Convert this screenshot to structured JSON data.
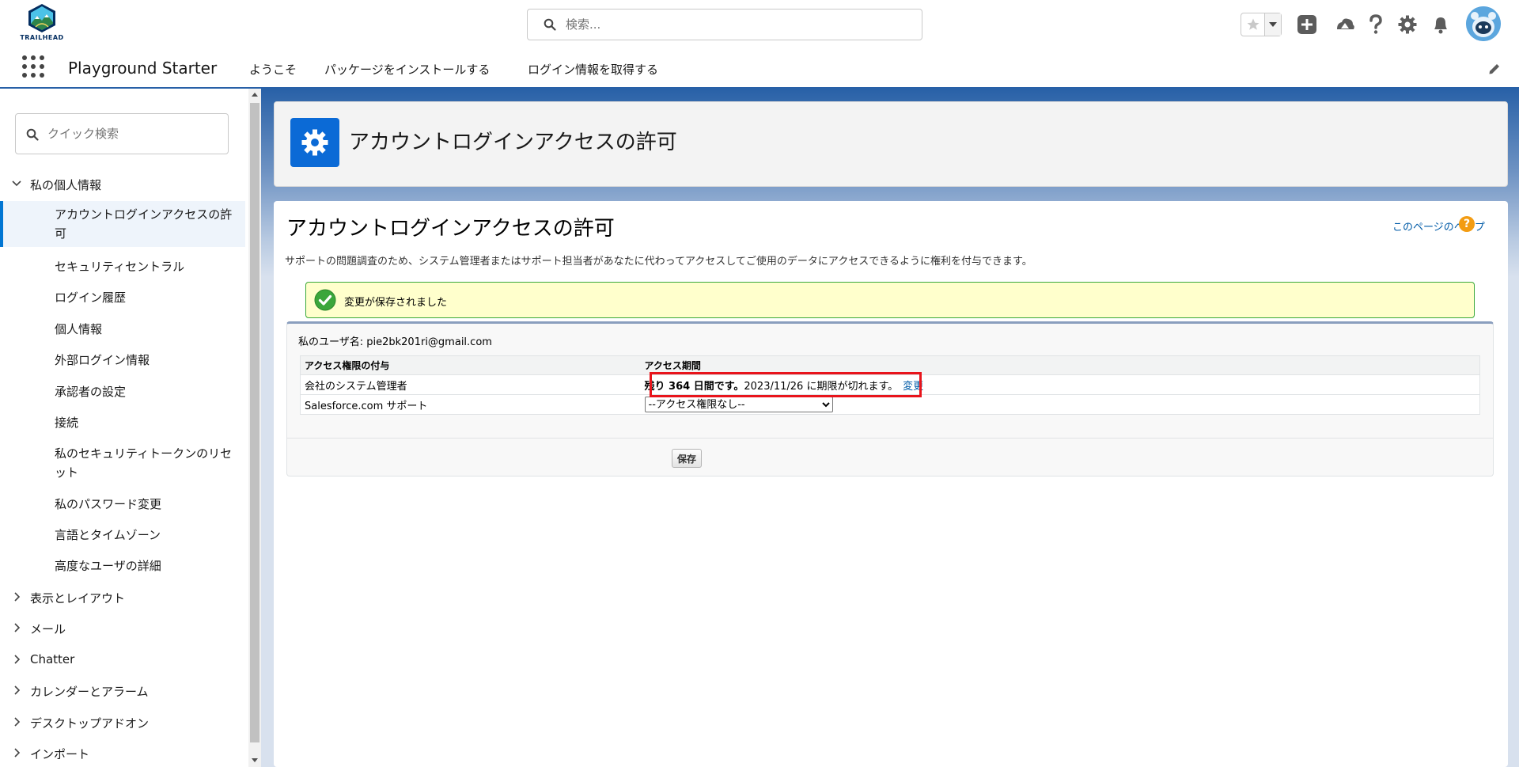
{
  "header": {
    "logo_text": "TRAILHEAD",
    "search_placeholder": "検索..."
  },
  "app_nav": {
    "app_name": "Playground Starter",
    "items": [
      "ようこそ",
      "パッケージをインストールする",
      "ログイン情報を取得する"
    ]
  },
  "sidebar": {
    "quick_find_placeholder": "クイック検索",
    "expanded_section": "私の個人情報",
    "children": [
      "アカウントログインアクセスの許可",
      "セキュリティセントラル",
      "ログイン履歴",
      "個人情報",
      "外部ログイン情報",
      "承認者の設定",
      "接続",
      "私のセキュリティトークンのリセット",
      "私のパスワード変更",
      "言語とタイムゾーン",
      "高度なユーザの詳細"
    ],
    "collapsed_sections": [
      "表示とレイアウト",
      "メール",
      "Chatter",
      "カレンダーとアラーム",
      "デスクトップアドオン",
      "インポート"
    ]
  },
  "page_header": {
    "title": "アカウントログインアクセスの許可"
  },
  "content": {
    "title": "アカウントログインアクセスの許可",
    "help_link": "このページのヘルプ",
    "description": "サポートの問題調査のため、システム管理者またはサポート担当者があなたに代わってアクセスしてご使用のデータにアクセスできるように権利を付与できます。",
    "success_message": "変更が保存されました",
    "user_line": "私のユーザ名: pie2bk201ri@gmail.com",
    "table": {
      "headers": [
        "アクセス権限の付与",
        "アクセス期間"
      ],
      "rows": [
        {
          "grantee": "会社のシステム管理者",
          "remaining": "残り 364 日間です。",
          "expiry": "2023/11/26 に期限が切れます。",
          "change_link": "変更"
        },
        {
          "grantee": "Salesforce.com サポート",
          "select_value": "--アクセス権限なし--"
        }
      ]
    },
    "save_label": "保存"
  }
}
